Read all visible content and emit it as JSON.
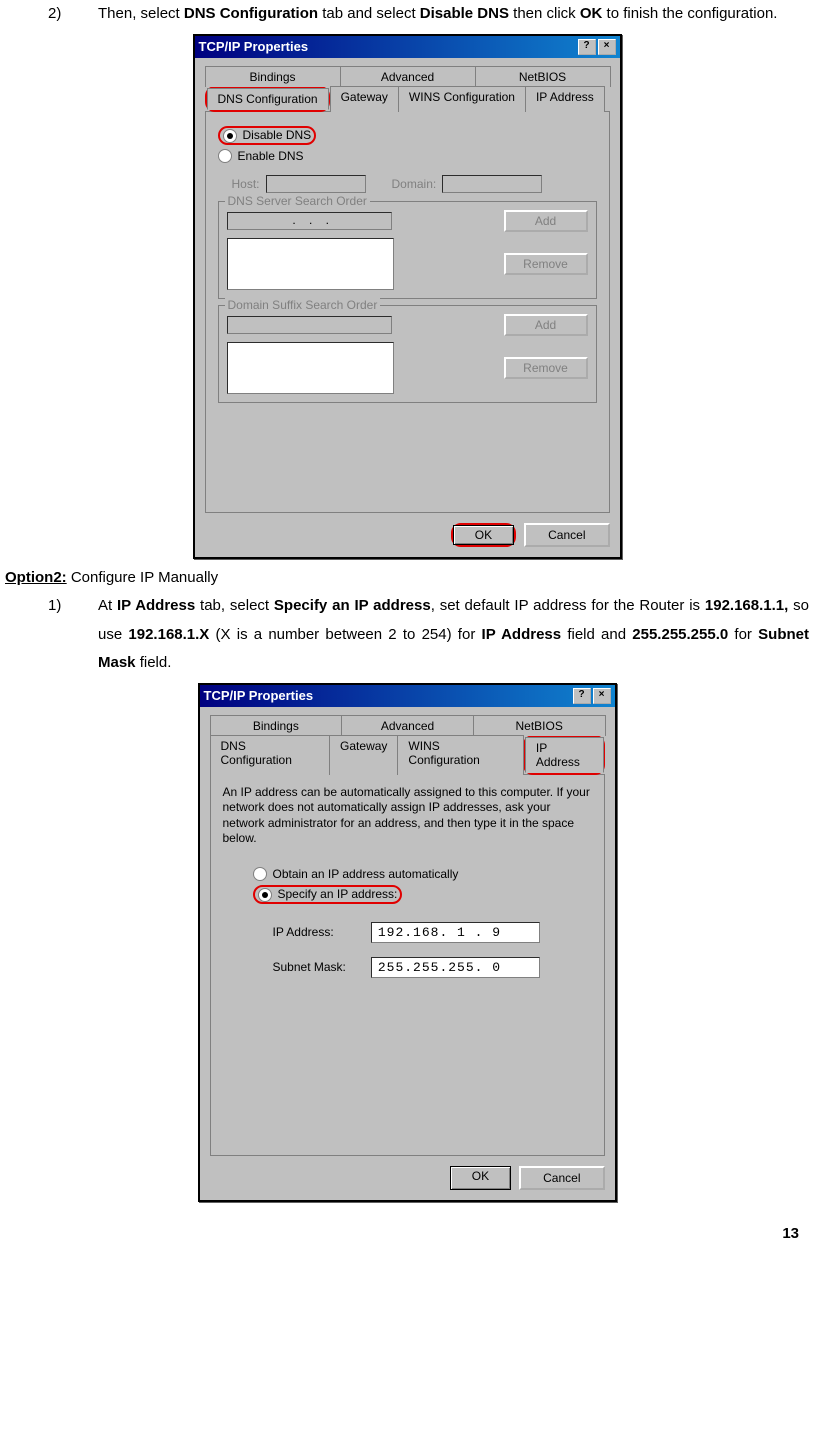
{
  "step2": {
    "num": "2)",
    "pre": "Then, select ",
    "b1": "DNS Configuration",
    "mid1": " tab and select ",
    "b2": "Disable DNS",
    "mid2": " then click ",
    "b3": "OK",
    "post": " to finish the configuration."
  },
  "dlg1": {
    "title": "TCP/IP Properties",
    "help": "?",
    "close": "×",
    "tabs": {
      "bindings": "Bindings",
      "advanced": "Advanced",
      "netbios": "NetBIOS",
      "dnsconf": "DNS Configuration",
      "gateway": "Gateway",
      "winsconf": "WINS Configuration",
      "ipaddr": "IP Address"
    },
    "disable_dns": "Disable DNS",
    "enable_dns": "Enable DNS",
    "host": "Host:",
    "domain": "Domain:",
    "dns_search": "DNS Server Search Order",
    "suffix_search": "Domain Suffix Search Order",
    "add": "Add",
    "remove": "Remove",
    "ok": "OK",
    "cancel": "Cancel"
  },
  "option2_label": "Option2:",
  "option2_text": " Configure IP Manually",
  "step1b": {
    "num": "1)",
    "t0": "At ",
    "b0": "IP Address",
    "t1": " tab, select ",
    "b1": "Specify an IP address",
    "t2": ", set default IP address for the Router is ",
    "b2": "192.168.1.1,",
    "t3": " so use ",
    "b3": "192.168.1.X",
    "t4": " (X is a number between 2 to 254) for ",
    "b4": "IP Address",
    "t5": " field and ",
    "b5": "255.255.255.0",
    "t6": " for ",
    "b6": "Subnet Mask",
    "t7": " field."
  },
  "dlg2": {
    "title": "TCP/IP Properties",
    "help": "?",
    "close": "×",
    "tabs": {
      "bindings": "Bindings",
      "advanced": "Advanced",
      "netbios": "NetBIOS",
      "dnsconf": "DNS Configuration",
      "gateway": "Gateway",
      "winsconf": "WINS Configuration",
      "ipaddr": "IP Address"
    },
    "info": "An IP address can be automatically assigned to this computer. If your network does not automatically assign IP addresses, ask your network administrator for an address, and then type it in the space below.",
    "obtain": "Obtain an IP address automatically",
    "specify": "Specify an IP address:",
    "ip_label": "IP Address:",
    "ip_value": "192.168. 1 . 9",
    "mask_label": "Subnet Mask:",
    "mask_value": "255.255.255. 0",
    "ok": "OK",
    "cancel": "Cancel"
  },
  "page_num": "13"
}
